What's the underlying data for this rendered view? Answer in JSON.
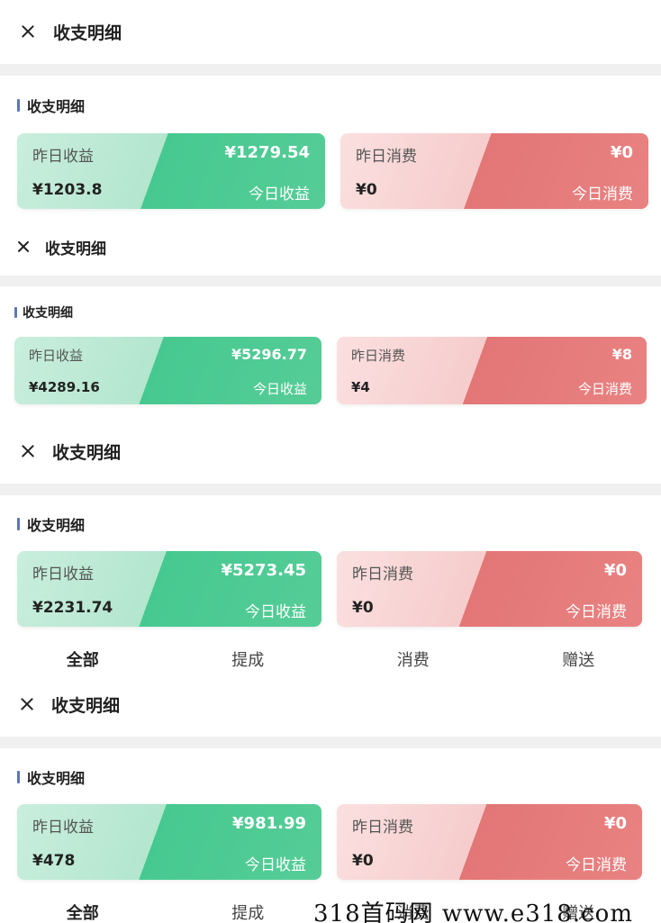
{
  "top_title": "收支明细",
  "section_title": "收支明细",
  "segments": [
    {
      "income_label": "昨日收益",
      "income_today": "¥1279.54",
      "income_yesterday": "¥1203.8",
      "income_today_label": "今日收益",
      "expense_label": "昨日消费",
      "expense_today": "¥0",
      "expense_yesterday": "¥0",
      "expense_today_label": "今日消费"
    },
    {
      "income_label": "昨日收益",
      "income_today": "¥5296.77",
      "income_yesterday": "¥4289.16",
      "income_today_label": "今日收益",
      "expense_label": "昨日消费",
      "expense_today": "¥8",
      "expense_yesterday": "¥4",
      "expense_today_label": "今日消费"
    },
    {
      "income_label": "昨日收益",
      "income_today": "¥5273.45",
      "income_yesterday": "¥2231.74",
      "income_today_label": "今日收益",
      "expense_label": "昨日消费",
      "expense_today": "¥0",
      "expense_yesterday": "¥0",
      "expense_today_label": "今日消费"
    },
    {
      "income_label": "昨日收益",
      "income_today": "¥981.99",
      "income_yesterday": "¥478",
      "income_today_label": "今日收益",
      "expense_label": "昨日消费",
      "expense_today": "¥0",
      "expense_yesterday": "¥0",
      "expense_today_label": "今日消费"
    }
  ],
  "tabs": [
    "全部",
    "提成",
    "消费",
    "赠送"
  ],
  "watermark": "318首码网  www.e318.com",
  "colors": {
    "income_green": "#46c990",
    "expense_red": "#e37676",
    "section_bar": "#5a78b5",
    "divider": "#f0f0f0"
  }
}
